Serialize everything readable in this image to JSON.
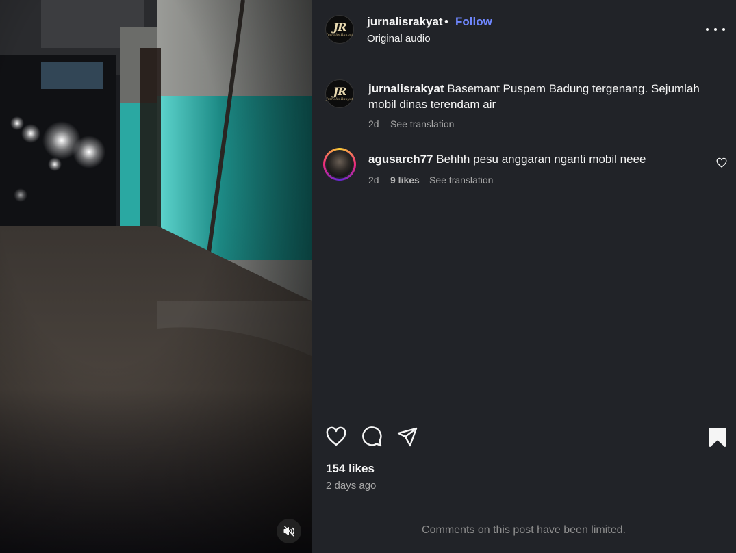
{
  "post": {
    "author": "jurnalisrakyat",
    "separator": "•",
    "follow_label": "Follow",
    "audio_label": "Original audio",
    "avatar_monogram": "JR",
    "avatar_subtitle": "Jurnalis Rakyat",
    "caption_user": "jurnalisrakyat",
    "caption_text": "Basemant Puspem Badung tergenang. Sejumlah mobil dinas terendam air",
    "caption_age": "2d",
    "caption_translate": "See translation"
  },
  "comments": [
    {
      "user": "agusarch77",
      "text": "Behhh pesu anggaran nganti mobil neee",
      "age": "2d",
      "likes": "9 likes",
      "translate": "See translation"
    }
  ],
  "stats": {
    "likes": "154 likes",
    "posted_ago": "2 days ago"
  },
  "footer": {
    "limited_notice": "Comments on this post have been limited."
  },
  "icons": {
    "mute": "speaker-muted-icon",
    "more": "more-options-icon",
    "like": "heart-icon",
    "comment": "comment-bubble-icon",
    "share": "paper-plane-icon",
    "save": "bookmark-filled-icon"
  },
  "colors": {
    "background": "#212328",
    "follow_link": "#6f87ff",
    "muted_text": "#a8a8a8"
  }
}
